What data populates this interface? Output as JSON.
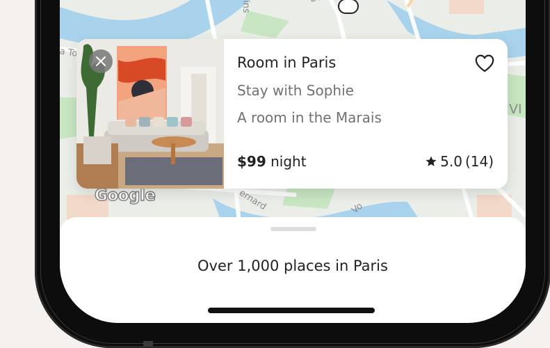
{
  "map": {
    "labels": [
      "Bd",
      "ins",
      "la To",
      "VI",
      "ernard",
      "Vo"
    ],
    "attribution": "Google"
  },
  "listing": {
    "title": "Room in Paris",
    "host": "Stay with Sophie",
    "description": "A room in the Marais",
    "price": "$99",
    "price_unit": "night",
    "rating": "5.0",
    "reviews": "(14)",
    "icons": {
      "close": "close-icon",
      "favorite": "heart-icon",
      "rating": "star-icon"
    }
  },
  "sheet": {
    "title": "Over 1,000 places in Paris"
  }
}
